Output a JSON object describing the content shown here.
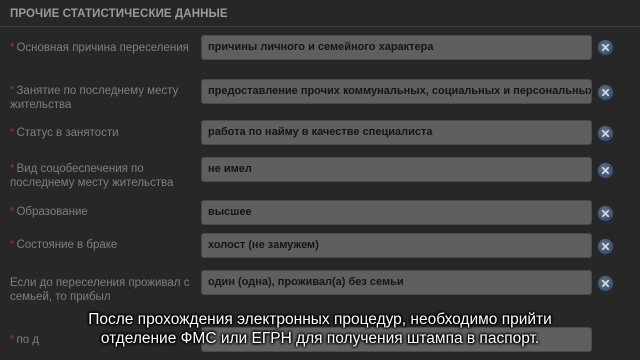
{
  "section": {
    "title": "ПРОЧИЕ СТАТИСТИЧЕСКИЕ ДАННЫЕ"
  },
  "form": {
    "required_mark": "*",
    "rows": [
      {
        "label": "Основная причина переселения",
        "required": true,
        "value": "причины личного и семейного характера"
      },
      {
        "label": "Занятие по последнему месту жительства",
        "required": true,
        "value": "предоставление прочих коммунальных, социальных и персональных у"
      },
      {
        "label": "Статус в занятости",
        "required": true,
        "value": "работа по найму в качестве специалиста"
      },
      {
        "label": "Вид соцобеспечения по последнему месту жительства",
        "required": true,
        "value": "не имел"
      },
      {
        "label": "Образование",
        "required": true,
        "value": "высшее"
      },
      {
        "label": "Состояние в браке",
        "required": true,
        "value": "холост (не замужем)"
      },
      {
        "label": "Если до переселения проживал с семьей, то прибыл",
        "required": false,
        "value": "один (одна), проживал(а) без семьи"
      },
      {
        "label": "по д",
        "required": true,
        "value": ""
      }
    ],
    "clear_icon": "close-icon"
  },
  "subtitles": {
    "line1": "После прохождения электронных процедур, необходимо прийти",
    "line2": "отделение ФМС или ЕГРН для получения штампа в паспорт."
  }
}
